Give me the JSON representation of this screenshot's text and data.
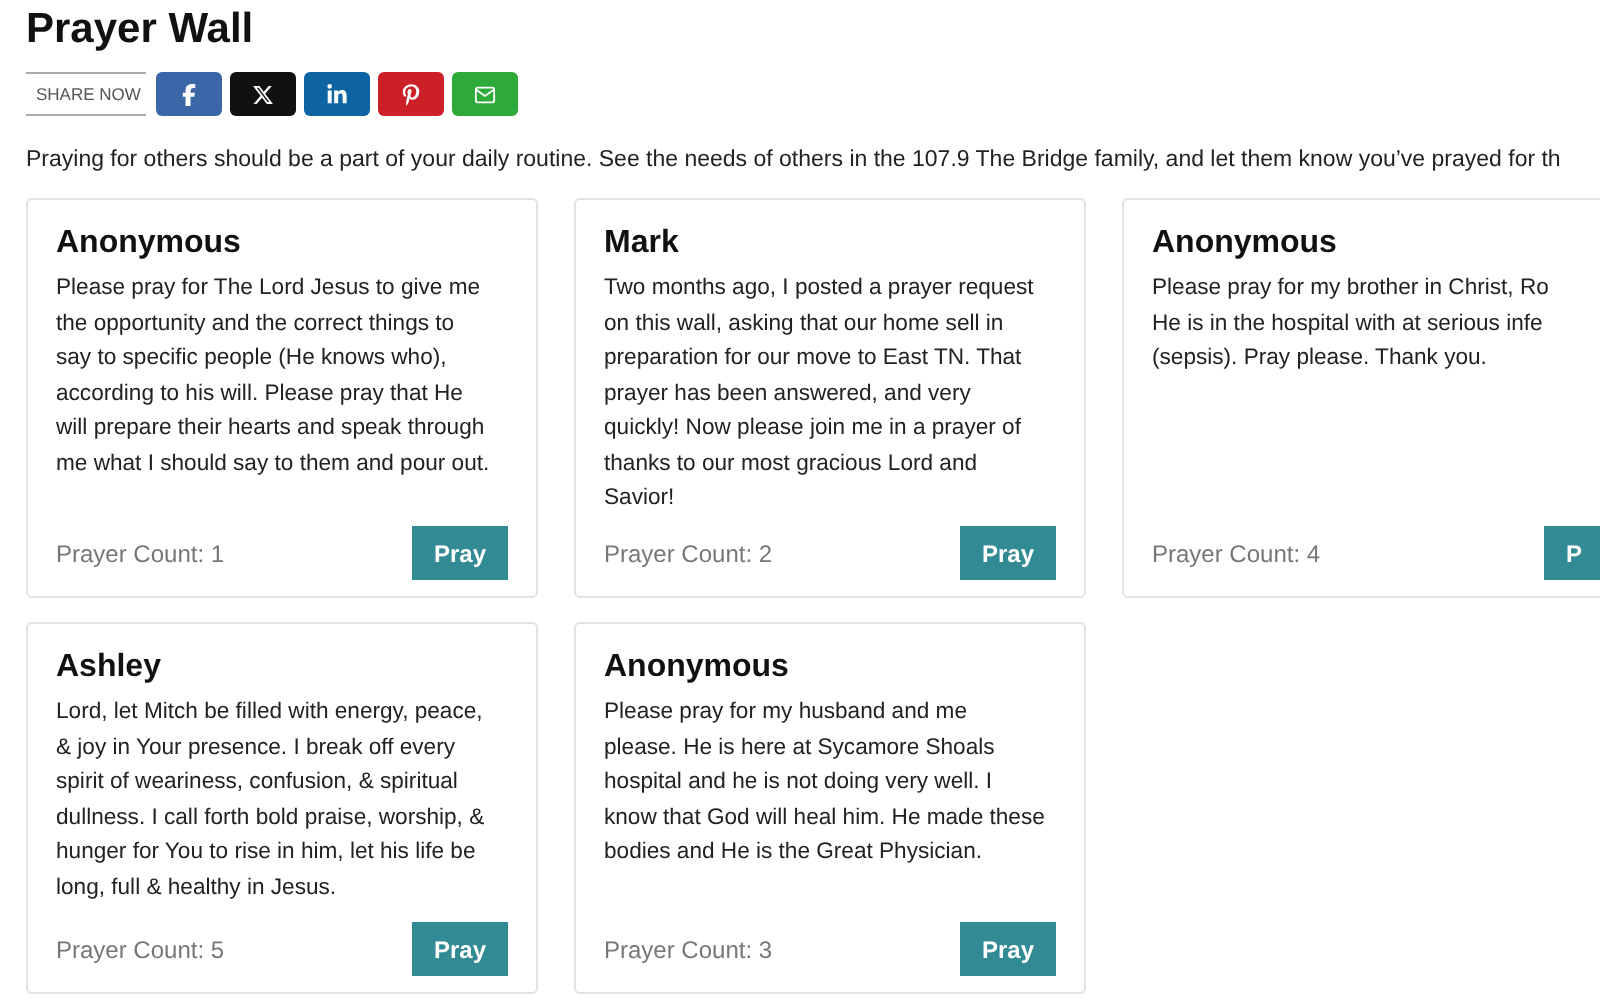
{
  "title": "Prayer Wall",
  "share": {
    "label": "SHARE NOW",
    "buttons": [
      {
        "kind": "facebook",
        "color": "#3b67a6"
      },
      {
        "kind": "x",
        "color": "#111111"
      },
      {
        "kind": "linkedin",
        "color": "#0e63a3"
      },
      {
        "kind": "pinterest",
        "color": "#cb2027"
      },
      {
        "kind": "email",
        "color": "#2eaa3a"
      }
    ]
  },
  "intro": "Praying for others should be a part of your daily routine. See the needs of others in the 107.9 The Bridge family, and let them know you’ve prayed for th",
  "rows": [
    [
      {
        "name": "Anonymous",
        "lines": [
          "Please pray for The Lord Jesus to give me",
          "the opportunity and the correct things to",
          "say to specific people (He knows who),",
          "according to his will. Please pray that He",
          "will prepare their hearts and speak through",
          "me what I should say to them and pour out."
        ],
        "count": "Prayer Count: 1",
        "button": "Pray"
      },
      {
        "name": "Mark",
        "lines": [
          "Two months ago, I posted a prayer request",
          "on this wall, asking that our home sell in",
          "preparation for our move to East TN. That",
          "prayer has been answered, and very",
          "quickly! Now please join me in a prayer of",
          "thanks to our most gracious Lord and",
          "Savior!"
        ],
        "count": "Prayer Count: 2",
        "button": "Pray"
      },
      {
        "name": "Anonymous",
        "lines": [
          "Please pray for my brother in Christ, Ro",
          "He is in the hospital with at serious infe",
          "(sepsis). Pray please. Thank you."
        ],
        "count": "Prayer Count: 4",
        "button": "P"
      }
    ],
    [
      {
        "name": "Ashley",
        "lines": [
          "Lord, let Mitch be filled with energy, peace,",
          "& joy in Your presence. I break off every",
          "spirit of weariness, confusion, & spiritual",
          "dullness. I call forth bold praise, worship, &",
          "hunger for You to rise in him, let his life be",
          "long, full & healthy in Jesus."
        ],
        "count": "Prayer Count: 5",
        "button": "Pray"
      },
      {
        "name": "Anonymous",
        "lines": [
          "Please pray for my husband and me",
          "please. He is here at Sycamore Shoals",
          "hospital and he is not doing very well. I",
          "know that God will heal him. He made these",
          "bodies and He is the Great Physician."
        ],
        "count": "Prayer Count: 3",
        "button": "Pray"
      }
    ]
  ]
}
